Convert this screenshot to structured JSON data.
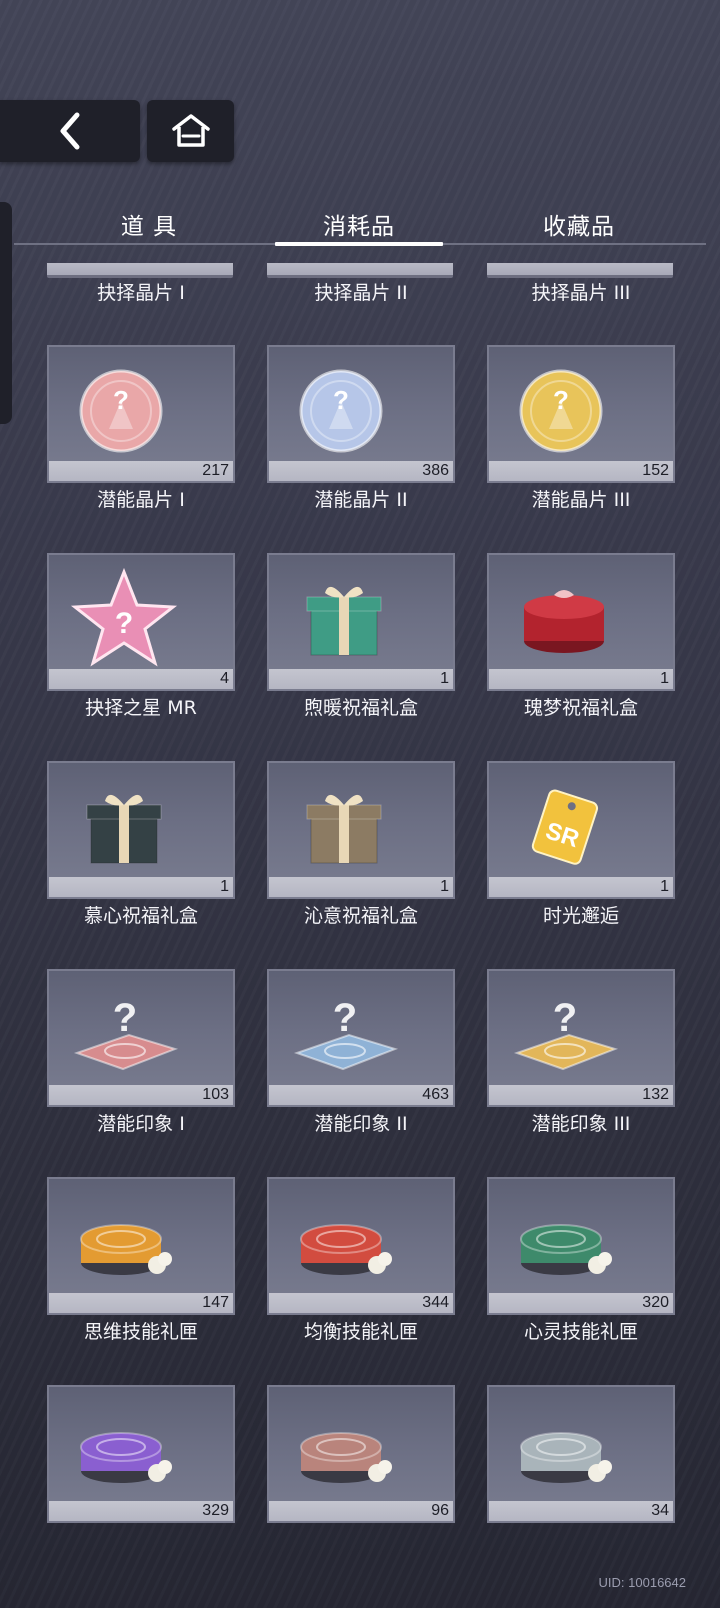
{
  "nav": {
    "back_icon": "chevron-left-icon",
    "home_icon": "home-icon"
  },
  "tabs": [
    {
      "label": "道 具",
      "active": false
    },
    {
      "label": "消耗品",
      "active": true
    },
    {
      "label": "收藏品",
      "active": false
    }
  ],
  "partial_row": [
    {
      "name": "抉择晶片 I"
    },
    {
      "name": "抉择晶片 II"
    },
    {
      "name": "抉择晶片 III"
    }
  ],
  "items": [
    {
      "name": "潜能晶片 I",
      "count": "217",
      "icon": "pink-crystal-chip-icon",
      "color": "#e9a7a8"
    },
    {
      "name": "潜能晶片 II",
      "count": "386",
      "icon": "blue-crystal-chip-icon",
      "color": "#b6c6e8"
    },
    {
      "name": "潜能晶片 III",
      "count": "152",
      "icon": "gold-crystal-chip-icon",
      "color": "#e8c45a"
    },
    {
      "name": "抉择之星 MR",
      "count": "4",
      "icon": "pink-star-icon",
      "color": "#e98fb5"
    },
    {
      "name": "煦暖祝福礼盒",
      "count": "1",
      "icon": "green-gift-box-icon",
      "color": "#3f9c85"
    },
    {
      "name": "瑰梦祝福礼盒",
      "count": "1",
      "icon": "red-round-gift-box-icon",
      "color": "#b3232e"
    },
    {
      "name": "慕心祝福礼盒",
      "count": "1",
      "icon": "dark-gift-box-icon",
      "color": "#344145"
    },
    {
      "name": "沁意祝福礼盒",
      "count": "1",
      "icon": "tan-gift-box-icon",
      "color": "#8c7b63"
    },
    {
      "name": "时光邂逅",
      "count": "1",
      "icon": "sr-tag-icon",
      "color": "#f2c23d"
    },
    {
      "name": "潜能印象 I",
      "count": "103",
      "icon": "pink-impression-icon",
      "color": "#d78c8e"
    },
    {
      "name": "潜能印象 II",
      "count": "463",
      "icon": "blue-impression-icon",
      "color": "#8fb2d6"
    },
    {
      "name": "潜能印象 III",
      "count": "132",
      "icon": "gold-impression-icon",
      "color": "#e2b65a"
    },
    {
      "name": "思维技能礼匣",
      "count": "147",
      "icon": "orange-skill-case-icon",
      "color": "#e39b32"
    },
    {
      "name": "均衡技能礼匣",
      "count": "344",
      "icon": "red-skill-case-icon",
      "color": "#d24c3f"
    },
    {
      "name": "心灵技能礼匣",
      "count": "320",
      "icon": "green-skill-case-icon",
      "color": "#3e8a6b"
    },
    {
      "name": "",
      "count": "329",
      "icon": "purple-skill-case-icon",
      "color": "#8a5fd0"
    },
    {
      "name": "",
      "count": "96",
      "icon": "rose-skill-case-icon",
      "color": "#b9847c"
    },
    {
      "name": "",
      "count": "34",
      "icon": "silver-skill-case-icon",
      "color": "#a9b4ba"
    }
  ],
  "uid": "UID: 10016642"
}
